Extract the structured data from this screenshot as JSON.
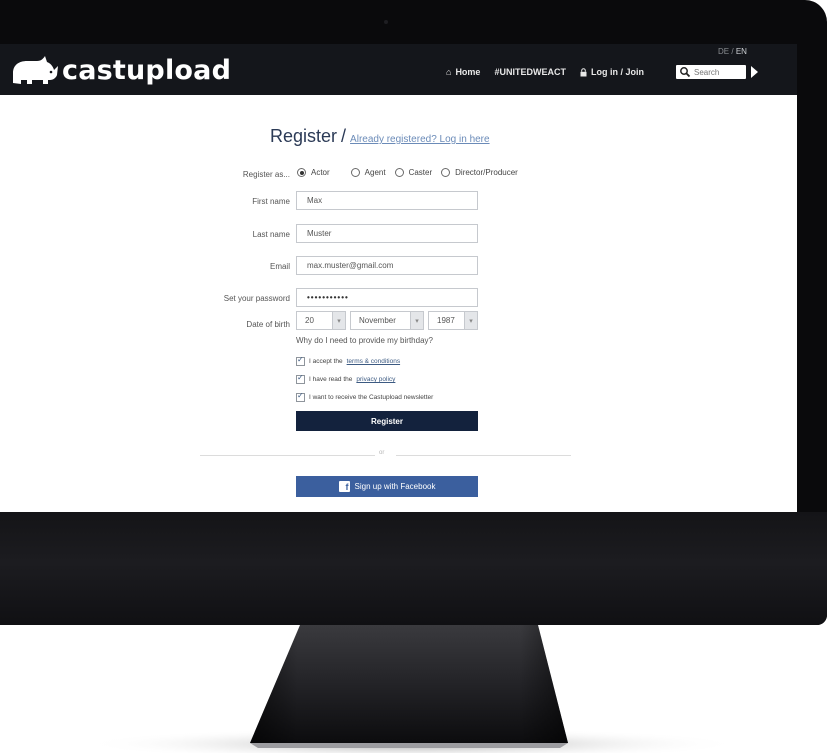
{
  "brand": {
    "name": "castupload"
  },
  "language": {
    "de": "DE",
    "separator": "/",
    "en": "EN"
  },
  "nav": {
    "home": "Home",
    "hashtag": "#UNITEDWEACT",
    "login": "Log in / Join"
  },
  "search": {
    "placeholder": "Search"
  },
  "form": {
    "title": "Register",
    "separator": "/",
    "already_link": "Already registered? Log in here",
    "register_as_label": "Register as...",
    "roles": [
      {
        "label": "Actor",
        "selected": true
      },
      {
        "label": "Agent",
        "selected": false
      },
      {
        "label": "Caster",
        "selected": false
      },
      {
        "label": "Director/Producer",
        "selected": false
      }
    ],
    "first_name": {
      "label": "First name",
      "value": "Max"
    },
    "last_name": {
      "label": "Last name",
      "value": "Muster"
    },
    "email": {
      "label": "Email",
      "value": "max.muster@gmail.com"
    },
    "password": {
      "label": "Set your password",
      "value": "•••••••••••"
    },
    "dob": {
      "label": "Date of birth",
      "day": "20",
      "month": "November",
      "year": "1987"
    },
    "why_birthday": "Why do I need to provide my birthday?",
    "checkboxes": {
      "terms": {
        "prefix": "I accept the ",
        "link": "terms & conditions",
        "checked": true
      },
      "privacy": {
        "prefix": "I have read the ",
        "link": "privacy policy",
        "checked": true
      },
      "newsletter": {
        "text": "I want to receive the Castupload newsletter",
        "checked": true
      }
    },
    "register_button": "Register",
    "or": "or",
    "facebook_button": "Sign up with Facebook"
  },
  "colors": {
    "topbar": "#14161b",
    "primary_button": "#13223d",
    "facebook": "#3b5f9e",
    "title": "#2b3a56",
    "link": "#6b8bb8"
  },
  "icons": {
    "logo": "rhino-icon",
    "home": "home-icon",
    "login": "lock-icon",
    "search": "search-icon",
    "search_submit": "play-arrow-icon",
    "facebook": "facebook-icon"
  }
}
